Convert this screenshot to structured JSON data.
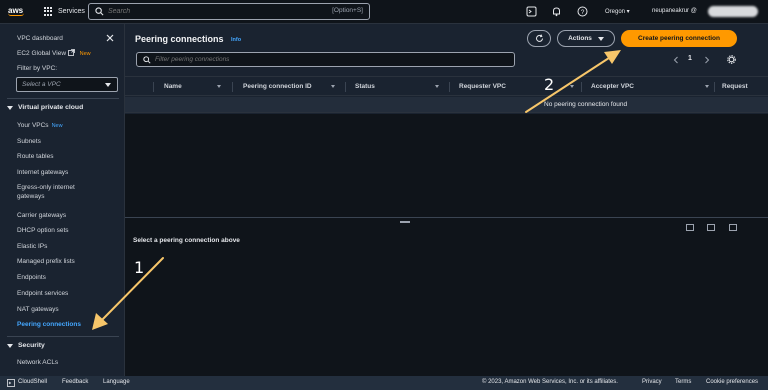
{
  "topbar": {
    "logo": "aws",
    "services_label": "Services",
    "search_placeholder": "Search",
    "search_shortcut": "[Option+S]",
    "region": "Oregon ▾",
    "user": "neupaneakrur @"
  },
  "sidebar": {
    "vpc_dashboard": "VPC dashboard",
    "ec2_global_view": "EC2 Global View",
    "ec2_new": "New",
    "filter_label": "Filter by VPC:",
    "filter_placeholder": "Select a VPC",
    "section_vpc": "Virtual private cloud",
    "items": [
      {
        "label": "Your VPCs",
        "badge": "New"
      },
      {
        "label": "Subnets"
      },
      {
        "label": "Route tables"
      },
      {
        "label": "Internet gateways"
      },
      {
        "label": "Egress-only internet gateways"
      },
      {
        "label": "Carrier gateways"
      },
      {
        "label": "DHCP option sets"
      },
      {
        "label": "Elastic IPs"
      },
      {
        "label": "Managed prefix lists"
      },
      {
        "label": "Endpoints"
      },
      {
        "label": "Endpoint services"
      },
      {
        "label": "NAT gateways"
      },
      {
        "label": "Peering connections"
      }
    ],
    "section_security": "Security",
    "security_items": [
      {
        "label": "Network ACLs"
      }
    ]
  },
  "main": {
    "title": "Peering connections",
    "info": "Info",
    "actions_label": "Actions",
    "create_label": "Create peering connection",
    "filter_placeholder": "Filter peering connections",
    "page_number": "1",
    "columns": [
      "Name",
      "Peering connection ID",
      "Status",
      "Requester VPC",
      "Accepter VPC",
      "Request"
    ],
    "empty_message": "No peering connection found",
    "split_title": "Select a peering connection above"
  },
  "footer": {
    "cloudshell": "CloudShell",
    "feedback": "Feedback",
    "language": "Language",
    "copyright": "© 2023, Amazon Web Services, Inc. or its affiliates.",
    "privacy": "Privacy",
    "terms": "Terms",
    "cookies": "Cookie preferences"
  },
  "annotations": {
    "step1": "1",
    "step2": "2",
    "arrow_color": "#f7c66a"
  },
  "colors": {
    "accent_orange": "#ff9900",
    "link_blue": "#44a7ff"
  }
}
